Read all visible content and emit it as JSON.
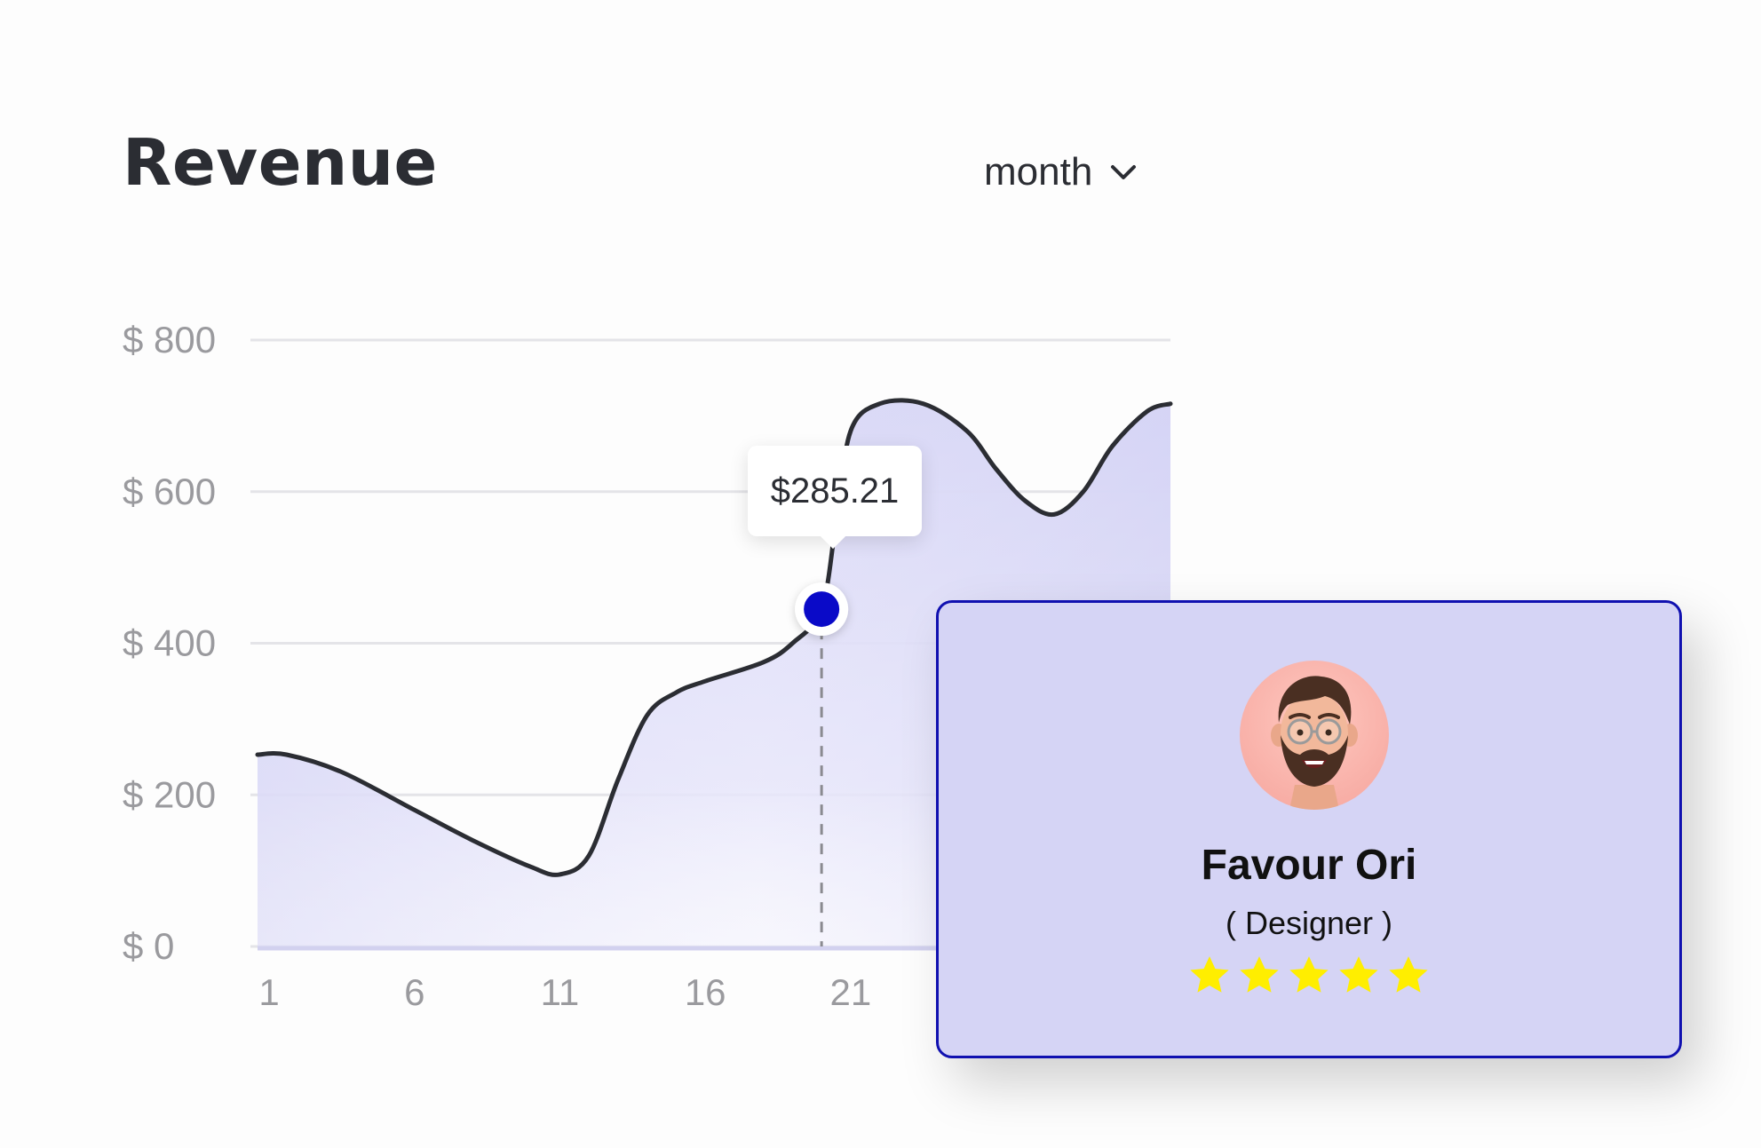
{
  "header": {
    "title": "Revenue",
    "period_select": {
      "value": "month"
    }
  },
  "tooltip": {
    "value": "$285.21"
  },
  "profile_card": {
    "name": "Favour Ori",
    "role": "( Designer )",
    "rating": 5,
    "rating_max": 5
  },
  "colors": {
    "accent": "#0a0ac8",
    "area_fill": "#d5d4f5",
    "line": "#2b2d33",
    "card_border": "#1010b0",
    "star": "#ffee00"
  },
  "chart_data": {
    "type": "area",
    "title": "Revenue",
    "y_ticks": [
      "$ 0",
      "$ 200",
      "$ 400",
      "$ 600",
      "$ 800"
    ],
    "y_tick_values": [
      0,
      200,
      400,
      600,
      800
    ],
    "x_ticks": [
      "1",
      "6",
      "11",
      "16",
      "21"
    ],
    "x_tick_values": [
      1,
      6,
      11,
      16,
      21
    ],
    "ylim": [
      0,
      800
    ],
    "xlim": [
      0.6,
      32.0
    ],
    "grid": true,
    "series": [
      {
        "values": [
          [
            0.6,
            253
          ],
          [
            1.6,
            253
          ],
          [
            3.5,
            230
          ],
          [
            6.0,
            180
          ],
          [
            8.0,
            140
          ],
          [
            10.0,
            105
          ],
          [
            11.0,
            95
          ],
          [
            12.0,
            120
          ],
          [
            13.0,
            220
          ],
          [
            14.0,
            305
          ],
          [
            15.0,
            335
          ],
          [
            16.0,
            350
          ],
          [
            18.0,
            375
          ],
          [
            19.0,
            400
          ],
          [
            20.0,
            445
          ],
          [
            20.5,
            560
          ],
          [
            21.0,
            680
          ],
          [
            22.0,
            716
          ],
          [
            23.5,
            716
          ],
          [
            25.0,
            680
          ],
          [
            26.0,
            630
          ],
          [
            27.0,
            588
          ],
          [
            28.0,
            570
          ],
          [
            29.0,
            600
          ],
          [
            30.0,
            660
          ],
          [
            31.2,
            706
          ],
          [
            32.0,
            716
          ]
        ]
      }
    ],
    "highlight": {
      "x": 20,
      "y": 445,
      "label": "$285.21"
    }
  }
}
